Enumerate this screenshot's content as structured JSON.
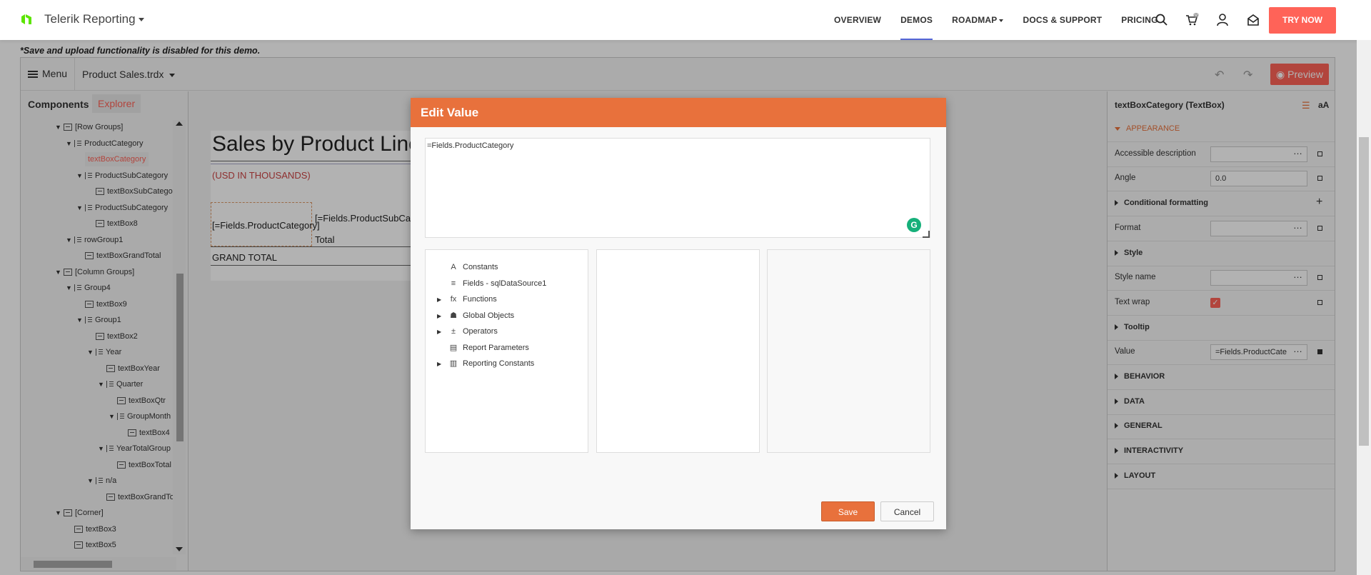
{
  "topnav": {
    "brand": "Telerik Reporting",
    "links": [
      "OVERVIEW",
      "DEMOS",
      "ROADMAP",
      "DOCS & SUPPORT",
      "PRICING"
    ],
    "try_now": "TRY NOW",
    "cart_count": "0"
  },
  "notice": "*Save and upload functionality is disabled for this demo.",
  "toolbar": {
    "menu": "Menu",
    "file": "Product Sales.trdx",
    "preview": "Preview"
  },
  "leftpanel": {
    "tabs": [
      "Components",
      "Explorer"
    ],
    "tree": [
      {
        "label": "[Row Groups]",
        "level": 1,
        "expanded": true,
        "icon": "table"
      },
      {
        "label": "ProductCategory",
        "level": 2,
        "expanded": true,
        "icon": "group"
      },
      {
        "label": "textBoxCategory",
        "level": 3,
        "icon": "textbox",
        "selected": true
      },
      {
        "label": "ProductSubCategory",
        "level": 3,
        "expanded": true,
        "icon": "group"
      },
      {
        "label": "textBoxSubCategory",
        "level": 4,
        "icon": "textbox"
      },
      {
        "label": "ProductSubCategory",
        "level": 3,
        "expanded": true,
        "icon": "group"
      },
      {
        "label": "textBox8",
        "level": 4,
        "icon": "textbox"
      },
      {
        "label": "rowGroup1",
        "level": 2,
        "expanded": true,
        "icon": "group"
      },
      {
        "label": "textBoxGrandTotal",
        "level": 3,
        "icon": "textbox"
      },
      {
        "label": "[Column Groups]",
        "level": 1,
        "expanded": true,
        "icon": "table"
      },
      {
        "label": "Group4",
        "level": 2,
        "expanded": true,
        "icon": "group"
      },
      {
        "label": "textBox9",
        "level": 3,
        "icon": "textbox"
      },
      {
        "label": "Group1",
        "level": 3,
        "expanded": true,
        "icon": "group"
      },
      {
        "label": "textBox2",
        "level": 4,
        "icon": "textbox"
      },
      {
        "label": "Year",
        "level": 4,
        "expanded": true,
        "icon": "group"
      },
      {
        "label": "textBoxYear",
        "level": 5,
        "icon": "textbox"
      },
      {
        "label": "Quarter",
        "level": 5,
        "expanded": true,
        "icon": "group"
      },
      {
        "label": "textBoxQtr",
        "level": 6,
        "icon": "textbox"
      },
      {
        "label": "GroupMonth",
        "level": 6,
        "expanded": true,
        "icon": "group"
      },
      {
        "label": "textBox4",
        "level": 7,
        "icon": "textbox"
      },
      {
        "label": "YearTotalGroup",
        "level": 5,
        "expanded": true,
        "icon": "group"
      },
      {
        "label": "textBoxTotal",
        "level": 6,
        "icon": "textbox"
      },
      {
        "label": "n/a",
        "level": 4,
        "expanded": true,
        "icon": "group"
      },
      {
        "label": "textBoxGrandTotal",
        "level": 5,
        "icon": "textbox"
      },
      {
        "label": "[Corner]",
        "level": 1,
        "expanded": true,
        "icon": "table"
      },
      {
        "label": "textBox3",
        "level": 2,
        "icon": "textbox"
      },
      {
        "label": "textBox5",
        "level": 2,
        "icon": "textbox"
      }
    ]
  },
  "report": {
    "title": "Sales by Product Line",
    "subtitle": "(USD IN THOUSANDS)",
    "cell_category": "[=Fields.ProductCategory]",
    "cell_subcategory": "[=Fields.ProductSubCate",
    "cell_total": "Total",
    "cell_grand_total": "GRAND TOTAL"
  },
  "props": {
    "header": "textBoxCategory (TextBox)",
    "header_icon_text": "aA",
    "rows": [
      {
        "type": "section",
        "label": "APPEARANCE",
        "expanded": true
      },
      {
        "type": "field",
        "label": "Accessible description",
        "value": "",
        "dots": true
      },
      {
        "type": "field",
        "label": "Angle",
        "value": "0.0",
        "dots": false
      },
      {
        "type": "group",
        "label": "Conditional formatting",
        "plus": true
      },
      {
        "type": "field",
        "label": "Format",
        "value": "",
        "dots": true
      },
      {
        "type": "group",
        "label": "Style"
      },
      {
        "type": "field",
        "label": "Style name",
        "value": "",
        "dots": true
      },
      {
        "type": "check",
        "label": "Text wrap",
        "checked": true
      },
      {
        "type": "group",
        "label": "Tooltip"
      },
      {
        "type": "field",
        "label": "Value",
        "value": "=Fields.ProductCate",
        "dots": true,
        "filled": true
      },
      {
        "type": "section",
        "label": "BEHAVIOR"
      },
      {
        "type": "section",
        "label": "DATA"
      },
      {
        "type": "section",
        "label": "GENERAL"
      },
      {
        "type": "section",
        "label": "INTERACTIVITY"
      },
      {
        "type": "section",
        "label": "LAYOUT"
      }
    ]
  },
  "modal": {
    "title": "Edit Value",
    "expression": "=Fields.ProductCategory",
    "badge": "G",
    "items": [
      {
        "label": "Constants",
        "icon": "A",
        "expandable": false
      },
      {
        "label": "Fields - sqlDataSource1",
        "icon": "≡",
        "expandable": false
      },
      {
        "label": "Functions",
        "icon": "fx",
        "expandable": true
      },
      {
        "label": "Global Objects",
        "icon": "☗",
        "expandable": true
      },
      {
        "label": "Operators",
        "icon": "±",
        "expandable": true
      },
      {
        "label": "Report Parameters",
        "icon": "▤",
        "expandable": false
      },
      {
        "label": "Reporting Constants",
        "icon": "▥",
        "expandable": true
      }
    ],
    "save": "Save",
    "cancel": "Cancel"
  }
}
